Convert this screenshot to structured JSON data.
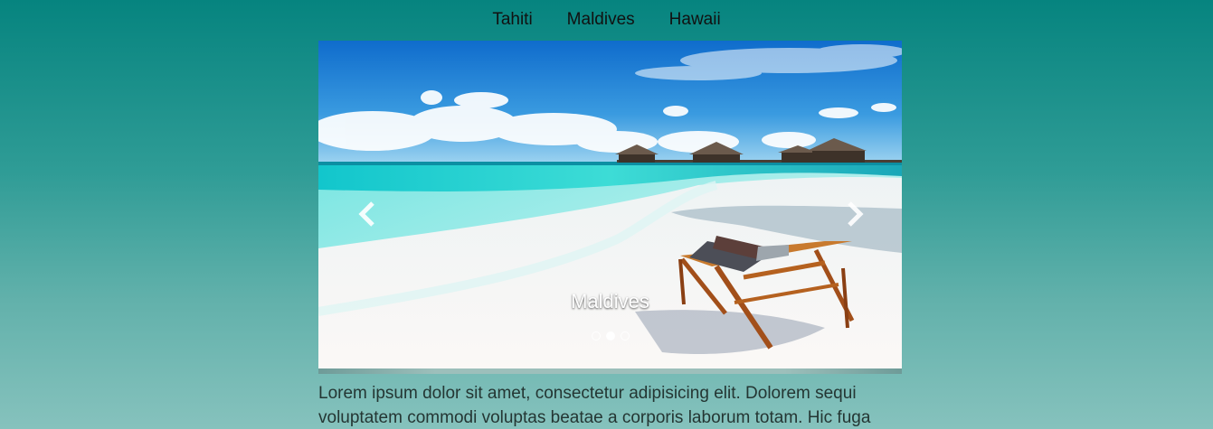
{
  "nav": {
    "items": [
      {
        "label": "Tahiti"
      },
      {
        "label": "Maldives"
      },
      {
        "label": "Hawaii"
      }
    ]
  },
  "carousel": {
    "caption": "Maldives",
    "prev_icon": "chevron-left-icon",
    "next_icon": "chevron-right-icon",
    "slides": 3,
    "active_slide": 2
  },
  "content": {
    "paragraph": "Lorem ipsum dolor sit amet, consectetur adipisicing elit. Dolorem sequi voluptatem commodi voluptas beatae a corporis laborum totam. Hic fuga"
  },
  "colors": {
    "background_top": "#06847f",
    "background_bottom": "#86c2bd",
    "sea": "#1fd0d1",
    "sky": "#1f86d6"
  }
}
